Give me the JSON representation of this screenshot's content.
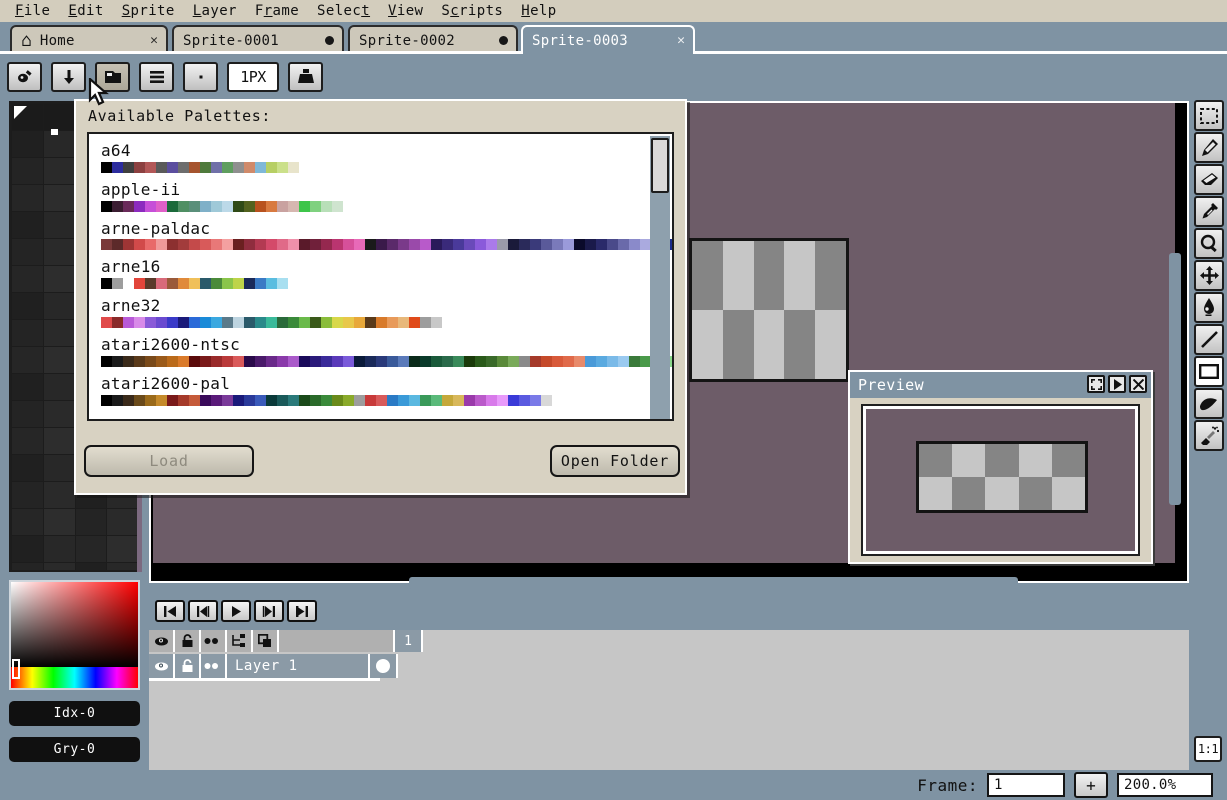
{
  "menubar": {
    "items": [
      {
        "label": "File",
        "accel": "F"
      },
      {
        "label": "Edit",
        "accel": "E"
      },
      {
        "label": "Sprite",
        "accel": "S"
      },
      {
        "label": "Layer",
        "accel": "L"
      },
      {
        "label": "Frame",
        "accel": "r"
      },
      {
        "label": "Select",
        "accel": "t"
      },
      {
        "label": "View",
        "accel": "V"
      },
      {
        "label": "Scripts",
        "accel": "c"
      },
      {
        "label": "Help",
        "accel": "H"
      }
    ]
  },
  "tabs": [
    {
      "label": "Home",
      "icon": "home-icon",
      "close": "✕",
      "active": false,
      "modified": false
    },
    {
      "label": "Sprite-0001",
      "icon": "",
      "close": "",
      "active": false,
      "modified": true
    },
    {
      "label": "Sprite-0002",
      "icon": "",
      "close": "",
      "active": false,
      "modified": true
    },
    {
      "label": "Sprite-0003",
      "icon": "",
      "close": "✕",
      "active": true,
      "modified": false
    }
  ],
  "context_toolbar": {
    "buttons": [
      {
        "name": "palette-options-icon",
        "label": ""
      },
      {
        "name": "palette-sort-icon",
        "label": ""
      },
      {
        "name": "palette-presets-icon",
        "label": ""
      },
      {
        "name": "palette-menu-icon",
        "label": ""
      },
      {
        "name": "palette-entry-icon",
        "label": ""
      },
      {
        "name": "pixel-size-field",
        "label": "1PX"
      },
      {
        "name": "ink-icon",
        "label": ""
      }
    ],
    "pixel_size_value": "1PX"
  },
  "palette_dialog": {
    "title": "Available Palettes:",
    "load_button": "Load",
    "open_folder_button": "Open Folder",
    "entries": [
      {
        "name": "a64",
        "truncated": false,
        "swatches": [
          "#000000",
          "#2c2c9e",
          "#3f3f3f",
          "#8c4040",
          "#b25757",
          "#5a5a5a",
          "#5b4e9e",
          "#6d6d6d",
          "#a5542e",
          "#4f7a3c",
          "#7070a8",
          "#5f9e5f",
          "#8f8f8f",
          "#d08a6a",
          "#7fb8d8",
          "#b7cf64",
          "#cbe08a",
          "#e8e4cb"
        ]
      },
      {
        "name": "apple-ii",
        "truncated": false,
        "swatches": [
          "#000000",
          "#3b1d32",
          "#6a2a5a",
          "#8c2bbf",
          "#c64fd8",
          "#e060c8",
          "#1b6a3a",
          "#4f8f63",
          "#5a8f7a",
          "#7fb0c8",
          "#9fc9d8",
          "#bcd9e8",
          "#2f4a16",
          "#53621e",
          "#b8521e",
          "#d87a40",
          "#c9a2a0",
          "#d6b7b0",
          "#3dc54a",
          "#7fd17f",
          "#b8dfb8",
          "#cfe4cf"
        ]
      },
      {
        "name": "arne-paldac",
        "truncated": true,
        "swatches": [
          "#7a3a3a",
          "#5c2a2a",
          "#9e3535",
          "#d14a4a",
          "#e86a6a",
          "#f09a9a",
          "#8c3030",
          "#a23c3c",
          "#c44a4a",
          "#d85a5a",
          "#e87878",
          "#f4a0a0",
          "#6a2020",
          "#8f2d3e",
          "#b33a52",
          "#d44a6a",
          "#e06a88",
          "#f090aa",
          "#5a1a2a",
          "#70203a",
          "#95284f",
          "#ba3570",
          "#d6509a",
          "#e86ab8",
          "#1a1a1a",
          "#3a1a4a",
          "#5a2a6a",
          "#7a3a8a",
          "#9a4aaa",
          "#b85aca",
          "#2a1a5a",
          "#3a2a7a",
          "#4a3a9a",
          "#6a4aba",
          "#8a5ada",
          "#aa7aea",
          "#9a9aaa",
          "#1a1a3a",
          "#2a2a5a",
          "#3a3a7a",
          "#5a5a9a",
          "#7a7aba",
          "#9a9ada",
          "#0a0a2a",
          "#1a1a4a",
          "#2a2a6a",
          "#4a4a8a",
          "#6a6aaa",
          "#8a8aca",
          "#aaaadf",
          "#cacaef",
          "#1a2a8a",
          "#2a3a9a",
          "#3a4aba",
          "#6a7ada",
          "#9aaaea",
          "#cadafa"
        ]
      },
      {
        "name": "arne16",
        "truncated": false,
        "swatches": [
          "#000000",
          "#9d9d9d",
          "#ffffff",
          "#e2453a",
          "#5a3a2a",
          "#d86a7a",
          "#9a5a3a",
          "#e08a3a",
          "#f0c05a",
          "#2a5a6a",
          "#4a8a3a",
          "#8ac54a",
          "#bdd44a",
          "#1a2a5a",
          "#3a7ac5",
          "#5abde0",
          "#a8dff0"
        ]
      },
      {
        "name": "arne32",
        "truncated": false,
        "swatches": [
          "#e04a4a",
          "#8a2a2a",
          "#b85ad8",
          "#d88ae8",
          "#8a5ad8",
          "#6a4ad0",
          "#3a3ac8",
          "#1a1a7a",
          "#2a6ad8",
          "#1a8ad8",
          "#3aa8e0",
          "#5a7a8a",
          "#bdd4e0",
          "#2a5a6a",
          "#2a8a8a",
          "#3aba9a",
          "#2a6a3a",
          "#3a8a3a",
          "#6aba4a",
          "#3a5a1a",
          "#8abd3a",
          "#d8d84a",
          "#e8c84a",
          "#e8a83a",
          "#5a3a1a",
          "#d87a2a",
          "#e89a5a",
          "#e8b87a",
          "#e04a1a",
          "#9d9d9d",
          "#c8c8c8"
        ]
      },
      {
        "name": "atari2600-ntsc",
        "truncated": true,
        "swatches": [
          "#000000",
          "#1a1a1a",
          "#3a2a1a",
          "#5a3a1a",
          "#7a4a1a",
          "#9a5a1a",
          "#ba6a1a",
          "#da7a2a",
          "#5a0a0a",
          "#7a1a1a",
          "#9a2a2a",
          "#ba3a3a",
          "#da5a5a",
          "#2a0a4a",
          "#4a1a6a",
          "#6a2a8a",
          "#8a3aaa",
          "#aa5aca",
          "#1a0a5a",
          "#2a1a7a",
          "#3a2a9a",
          "#5a3aba",
          "#7a5ada",
          "#0a1a3a",
          "#1a2a5a",
          "#2a3a7a",
          "#3a5a9a",
          "#5a7aba",
          "#0a2a1a",
          "#0a3a2a",
          "#1a5a3a",
          "#2a6a4a",
          "#3a8a5a",
          "#1a3a0a",
          "#2a5a1a",
          "#3a6a2a",
          "#5a8a3a",
          "#7aaa5a",
          "#8a8a8a",
          "#a53a2a",
          "#c54a2a",
          "#d85a3a",
          "#e06a4a",
          "#e88a6a",
          "#4a9ad8",
          "#5aaae0",
          "#7abae8",
          "#9acaf0",
          "#3a7a3a",
          "#4a9a4a",
          "#6aba6a",
          "#8ad88a",
          "#d8a83a",
          "#e0b85a",
          "#e8c87a",
          "#7a4a9a",
          "#9a5aba",
          "#ba7ada",
          "#9d9d9d",
          "#d85a7a",
          "#e07a9a",
          "#e89aba",
          "#c83a8a",
          "#d85a9a",
          "#e87aba",
          "#8a3aca",
          "#9a5ada",
          "#baaaea"
        ]
      },
      {
        "name": "atari2600-pal",
        "truncated": false,
        "swatches": [
          "#000000",
          "#1a1a1a",
          "#3a2a1a",
          "#6a4a1a",
          "#9a6a1a",
          "#c58a2a",
          "#7a1a1a",
          "#a53a2a",
          "#c55a3a",
          "#3a0a5a",
          "#5a1a7a",
          "#7a3a9a",
          "#1a1a7a",
          "#2a3a9a",
          "#3a5aba",
          "#0a3a3a",
          "#1a5a5a",
          "#2a7a7a",
          "#1a4a1a",
          "#2a6a2a",
          "#3a8a3a",
          "#6a8a1a",
          "#8aaa2a",
          "#9d9d9d",
          "#c83a3a",
          "#d85a5a",
          "#2a7ac5",
          "#3a9ad8",
          "#5ab8e0",
          "#3a9a5a",
          "#5aba7a",
          "#c5a83a",
          "#d8b85a",
          "#9a3aaa",
          "#ba5aca",
          "#d87aea",
          "#e89afa",
          "#3a3ad8",
          "#5a5ae0",
          "#7a7ae8",
          "#d8d8d8"
        ]
      }
    ]
  },
  "preview_window": {
    "title": "Preview",
    "buttons": [
      "maximize-icon",
      "play-icon",
      "close-icon"
    ],
    "sprite_colors": [
      "#858585",
      "#c6c6c6",
      "#858585",
      "#c6c6c6",
      "#858585",
      "#c6c6c6",
      "#858585",
      "#c6c6c6",
      "#858585",
      "#c6c6c6"
    ]
  },
  "canvas": {
    "background_color": "#6d5c68",
    "sprite_colors": [
      "#858585",
      "#c6c6c6",
      "#858585",
      "#c6c6c6",
      "#858585",
      "#c6c6c6",
      "#858585",
      "#c6c6c6",
      "#858585",
      "#c6c6c6"
    ]
  },
  "color_picker": {
    "index_button": "Idx-0",
    "gray_button": "Gry-0"
  },
  "toolbox": {
    "tools": [
      {
        "name": "rectangular-marquee-icon",
        "selected": false
      },
      {
        "name": "pencil-icon",
        "selected": false
      },
      {
        "name": "eraser-icon",
        "selected": false
      },
      {
        "name": "eyedropper-icon",
        "selected": false
      },
      {
        "name": "zoom-icon",
        "selected": false
      },
      {
        "name": "move-icon",
        "selected": false
      },
      {
        "name": "paint-bucket-icon",
        "selected": false
      },
      {
        "name": "line-icon",
        "selected": false
      },
      {
        "name": "rectangle-icon",
        "selected": true
      },
      {
        "name": "contour-icon",
        "selected": false
      },
      {
        "name": "spray-icon",
        "selected": false
      }
    ],
    "zoom_reset": "1:1"
  },
  "timeline": {
    "nav_buttons": [
      "first-frame-icon",
      "prev-frame-icon",
      "play-icon",
      "next-frame-icon",
      "last-frame-icon"
    ],
    "header_icons": [
      "eye-icon",
      "lock-icon",
      "continuous-icon",
      "group-icon",
      "duplicate-icon"
    ],
    "frame_numbers": [
      "1"
    ],
    "layers": [
      {
        "name": "Layer 1",
        "visible": true,
        "locked": false,
        "continuous": true
      }
    ]
  },
  "statusbar": {
    "frame_label": "Frame:",
    "frame_value": "1",
    "add_frame_label": "+",
    "zoom_value": "200.0%"
  }
}
